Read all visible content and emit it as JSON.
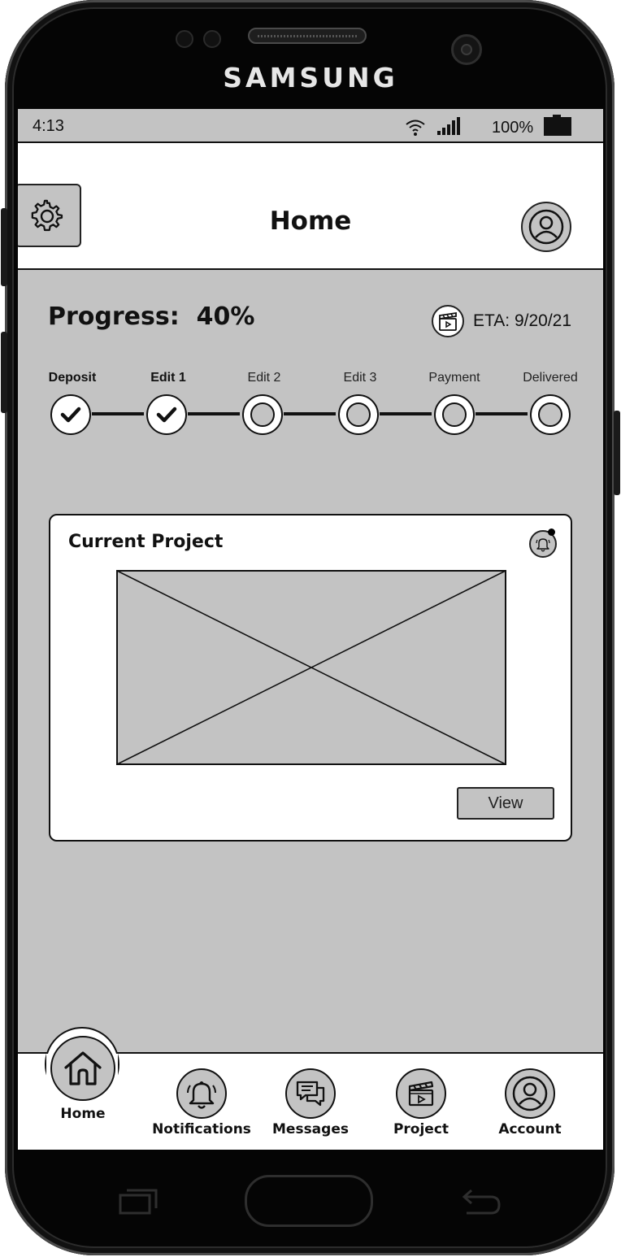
{
  "device": {
    "brand": "SAMSUNG"
  },
  "status_bar": {
    "time": "4:13",
    "battery": "100%",
    "icons": [
      "wifi-icon",
      "signal-icon",
      "battery-icon"
    ]
  },
  "header": {
    "title": "Home",
    "settings_icon": "gear-icon",
    "profile_icon": "user-icon"
  },
  "progress": {
    "label": "Progress:  40%",
    "percent": 40,
    "eta": "ETA: 9/20/21",
    "eta_icon": "clapperboard-icon",
    "stages": [
      {
        "label": "Deposit",
        "done": true
      },
      {
        "label": "Edit 1",
        "done": true
      },
      {
        "label": "Edit 2",
        "done": false
      },
      {
        "label": "Edit 3",
        "done": false
      },
      {
        "label": "Payment",
        "done": false
      },
      {
        "label": "Delivered",
        "done": false
      }
    ]
  },
  "current_project": {
    "title": "Current Project",
    "notification_icon": "bell-icon",
    "image_icon": "image-placeholder",
    "view_label": "View"
  },
  "nav": {
    "items": [
      {
        "label": "Home",
        "icon": "home-icon",
        "active": true
      },
      {
        "label": "Notifications",
        "icon": "bell-icon",
        "active": false
      },
      {
        "label": "Messages",
        "icon": "chat-icon",
        "active": false
      },
      {
        "label": "Project",
        "icon": "clapperboard-icon",
        "active": false
      },
      {
        "label": "Account",
        "icon": "user-icon",
        "active": false
      }
    ]
  },
  "colors": {
    "screen_bg": "#c3c3c3",
    "surface": "#ffffff",
    "ink": "#111111",
    "bezel": "#050505"
  }
}
